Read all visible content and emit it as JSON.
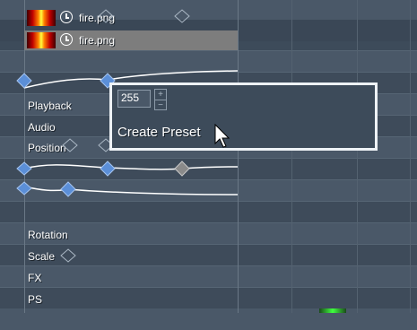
{
  "files": [
    {
      "name": "fire.png",
      "selected": false
    },
    {
      "name": "fire.png",
      "selected": true
    }
  ],
  "tracks": {
    "playback": "Playback",
    "audio": "Audio",
    "position": "Position",
    "rotation": "Rotation",
    "scale": "Scale",
    "fx": "FX",
    "ps": "PS"
  },
  "popup": {
    "value": "255",
    "spin_up": "+",
    "spin_down": "−",
    "create_preset": "Create Preset"
  },
  "colors": {
    "keyframe_active": "#5b8fd8",
    "keyframe_inactive": "#8a8a8a",
    "selected_row": "#7d7d7d",
    "background": "#3d4b5a"
  }
}
